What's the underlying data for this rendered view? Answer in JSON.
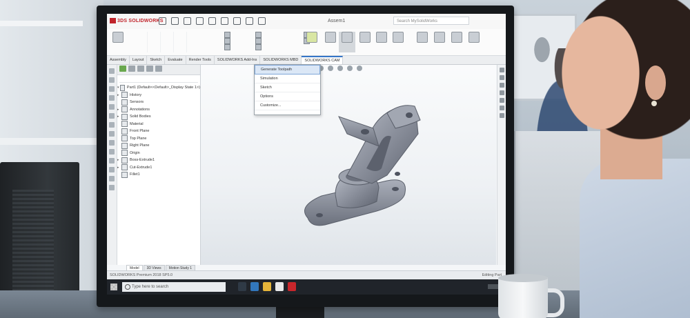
{
  "app": {
    "brand": "3DS SOLIDWORKS",
    "document_title": "Assem1",
    "search_placeholder": "Search MySolidWorks"
  },
  "command_tabs": [
    "Assembly",
    "Layout",
    "Sketch",
    "Evaluate",
    "Render Tools",
    "SOLIDWORKS Add-Ins",
    "SOLIDWORKS MBD",
    "SOLIDWORKS CAM"
  ],
  "dropdown_menu": [
    "Generate Toolpath",
    "Simulation",
    "Sketch",
    "Options",
    "Customize..."
  ],
  "feature_tree": [
    "Part1 (Default<<Default>_Display State 1>)",
    "History",
    "Sensors",
    "Annotations",
    "Solid Bodies",
    "Material",
    "Front Plane",
    "Top Plane",
    "Right Plane",
    "Origin",
    "Boss-Extrude1",
    "Cut-Extrude1",
    "Fillet1"
  ],
  "sheet_tabs": [
    "Model",
    "3D Views",
    "Motion Study 1"
  ],
  "status_bar": {
    "left": "SOLIDWORKS Premium 2018 SP5.0",
    "right": "Editing Part"
  },
  "taskbar": {
    "search_placeholder": "Type here to search"
  },
  "icons": [
    "windows-start-icon",
    "search-icon",
    "edge-icon",
    "file-explorer-icon",
    "store-icon",
    "solidworks-icon"
  ]
}
